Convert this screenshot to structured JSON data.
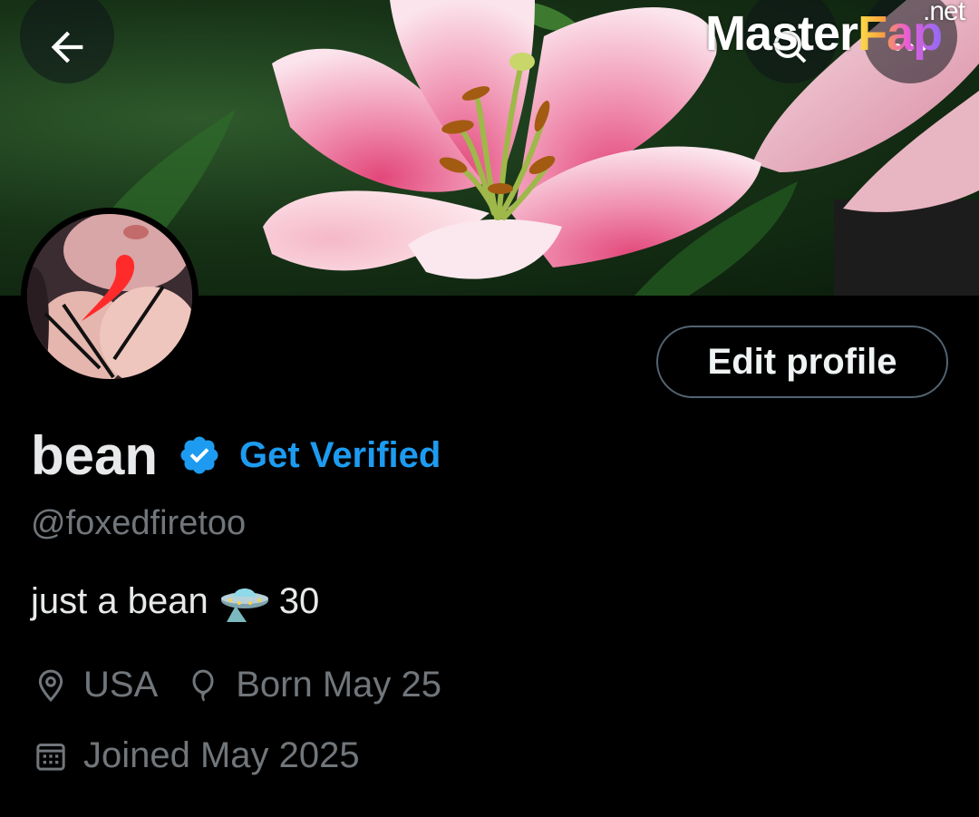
{
  "banner": {
    "back_icon": "arrow-left-icon",
    "search_icon": "search-icon",
    "more_icon": "more-icon"
  },
  "watermark": {
    "part1": "Master",
    "part2": "Fap",
    "suffix": ".net"
  },
  "profile": {
    "display_name": "bean",
    "verified_icon": "verified-badge-icon",
    "get_verified_label": "Get Verified",
    "handle": "@foxedfiretoo",
    "bio_text": "just a bean",
    "bio_emoji": "ufo-icon",
    "bio_suffix": "30",
    "location": "USA",
    "birthday": "Born May 25",
    "joined": "Joined May 2025",
    "edit_button_label": "Edit profile"
  },
  "colors": {
    "background": "#000000",
    "primary_text": "#e7e9ea",
    "secondary_text": "#71767b",
    "accent": "#1d9bf0",
    "border": "#536471"
  }
}
